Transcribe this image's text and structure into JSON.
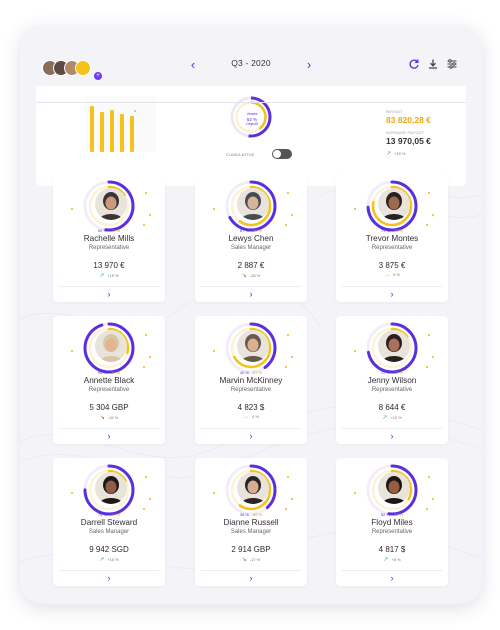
{
  "header": {
    "period": "Q3 - 2020",
    "prev_icon": "chevron-left-icon",
    "next_icon": "chevron-right-icon",
    "tools": [
      "refresh-icon",
      "download-icon",
      "filter-icon"
    ]
  },
  "summary": {
    "ring_text_top": "Ventes",
    "ring_value": "52 %",
    "ring_text_bottom": "Objectif",
    "toggle_label": "CUMULATIVE",
    "kpi1_label": "PAYOUT",
    "kpi1_value": "83 820,28 €",
    "kpi2_label": "AVERAGE PAYOUT",
    "kpi2_value": "13 970,05 €",
    "kpi2_trend": "+15 %"
  },
  "colors": {
    "accent_purple": "#5a2fe0",
    "accent_yellow": "#f4c21a",
    "up": "#2bb673",
    "down": "#e0483a",
    "flat": "#f0a030"
  },
  "cards": [
    {
      "name": "Rachelle Mills",
      "role": "Representative",
      "amount": "13 970 €",
      "trend": "+15 %",
      "trend_dir": "up",
      "pct1": "52 %",
      "pct2": "15 %",
      "ring_outer": 0.52,
      "ring_inner": 0.15
    },
    {
      "name": "Lewys Chen",
      "role": "Sales Manager",
      "amount": "2 887 €",
      "trend": "-28 %",
      "trend_dir": "down",
      "pct1": "67 %",
      "pct2": "60 %",
      "ring_outer": 0.67,
      "ring_inner": 0.6
    },
    {
      "name": "Trevor Montes",
      "role": "Representative",
      "amount": "3 875 €",
      "trend": "0 %",
      "trend_dir": "flat",
      "pct1": "74 %",
      "pct2": "78 %",
      "ring_outer": 0.74,
      "ring_inner": 0.78
    },
    {
      "name": "Annette Black",
      "role": "Representative",
      "amount": "5 304 GBP",
      "trend": "-16 %",
      "trend_dir": "down",
      "pct1": "95 %",
      "pct2": "29 %",
      "ring_outer": 0.95,
      "ring_inner": 0.29
    },
    {
      "name": "Marvin McKinney",
      "role": "Representative",
      "amount": "4 823 $",
      "trend": "0 %",
      "trend_dir": "flat",
      "pct1": "40 %",
      "pct2": "67 %",
      "ring_outer": 0.4,
      "ring_inner": 0.67
    },
    {
      "name": "Jenny Wilson",
      "role": "Representative",
      "amount": "8 644 €",
      "trend": "+22 %",
      "trend_dir": "up",
      "pct1": "72 %",
      "pct2": "15 %",
      "ring_outer": 0.72,
      "ring_inner": 0.15
    },
    {
      "name": "Darrell Steward",
      "role": "Sales Manager",
      "amount": "9 942 SGD",
      "trend": "+15 %",
      "trend_dir": "up",
      "pct1": "75 %",
      "pct2": "17 %",
      "ring_outer": 0.75,
      "ring_inner": 0.17
    },
    {
      "name": "Dianne Russell",
      "role": "Sales Manager",
      "amount": "2 914 GBP",
      "trend": "-17 %",
      "trend_dir": "down",
      "pct1": "38 %",
      "pct2": "60 %",
      "ring_outer": 0.38,
      "ring_inner": 0.6
    },
    {
      "name": "Floyd Miles",
      "role": "Representative",
      "amount": "4 817 $",
      "trend": "+8 %",
      "trend_dir": "up",
      "pct1": "52 %",
      "pct2": "33 %",
      "ring_outer": 0.52,
      "ring_inner": 0.33
    }
  ]
}
